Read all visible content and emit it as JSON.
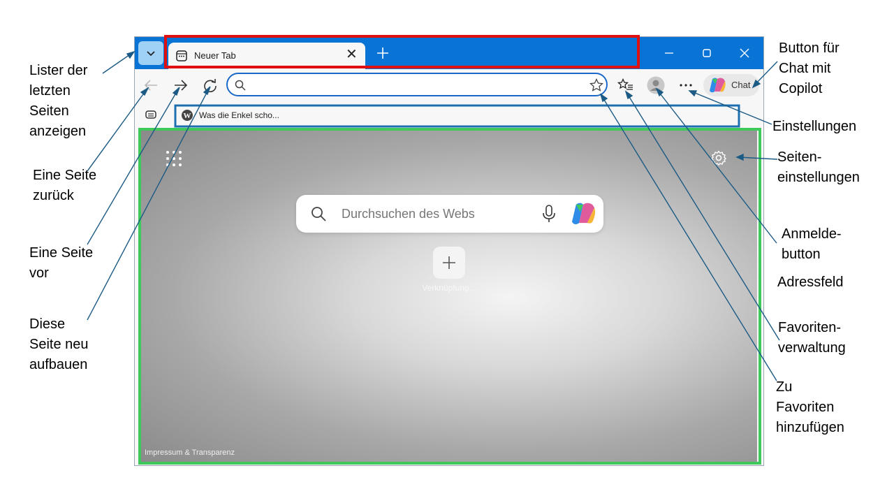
{
  "browser": {
    "tab": {
      "title": "Neuer Tab",
      "close": "✕"
    },
    "new_tab": "+",
    "window_controls": {
      "minimize": "–",
      "maximize": "□",
      "close": "✕"
    },
    "toolbar": {
      "chat_label": "Chat"
    },
    "favorites_bar": {
      "item_label": "Was die Enkel scho..."
    },
    "content": {
      "search_placeholder": "Durchsuchen des Webs",
      "shortcut_label": "Verknüpfung...",
      "footer_link": "Impressum & Transparenz"
    }
  },
  "annotations": {
    "recent_pages": "Lister der\nletzten\nSeiten\nanzeigen",
    "back": "Eine Seite\nzurück",
    "forward": "Eine Seite\nvor",
    "reload": "Diese\nSeite neu\naufbauen",
    "chat_button": "Button für\nChat  mit\nCopilot",
    "settings": "Einstellungen",
    "page_settings": "Seiten-\neinstellungen",
    "login_button": "Anmelde-\nbutton",
    "address_field": "Adressfeld",
    "favorites_manager": "Favoriten-\nverwaltung",
    "add_favorites": "Zu\nFavoriten\nhinzufügen"
  },
  "colors": {
    "titlebar": "#0a74d6",
    "tabs_highlight": "#e01010",
    "favbar_highlight": "#1e6fb0",
    "content_highlight": "#3ec95a",
    "leader_lines": "#1b5a84"
  },
  "icons": [
    "chevron-down-icon",
    "tab-page-icon",
    "close-icon",
    "plus-icon",
    "minimize-icon",
    "maximize-icon",
    "back-arrow-icon",
    "forward-arrow-icon",
    "reload-icon",
    "search-icon",
    "star-icon",
    "favorites-list-icon",
    "profile-icon",
    "more-dots-icon",
    "copilot-icon",
    "collections-icon",
    "wordpress-icon",
    "apps-grid-icon",
    "gear-icon",
    "microphone-icon"
  ]
}
